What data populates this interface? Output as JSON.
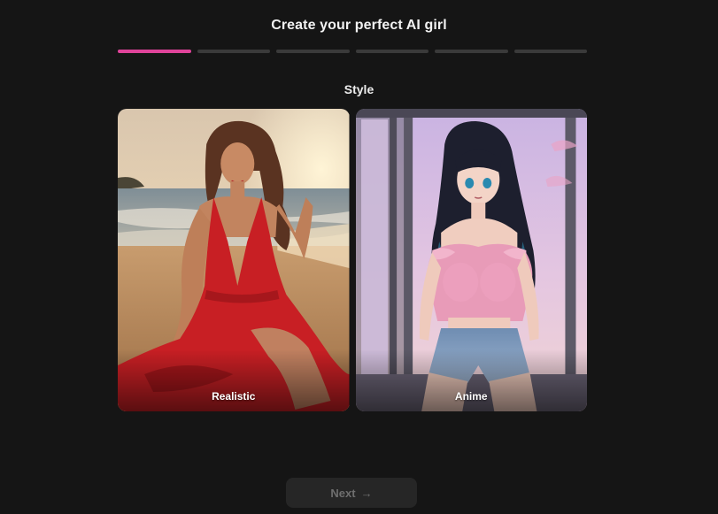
{
  "header": {
    "title": "Create your perfect AI girl"
  },
  "progress": {
    "total_steps": 6,
    "current_step": 1
  },
  "section": {
    "title": "Style"
  },
  "options": [
    {
      "label": "Realistic"
    },
    {
      "label": "Anime"
    }
  ],
  "footer": {
    "next_label": "Next",
    "next_icon": "arrow-right-icon",
    "next_enabled": false
  },
  "colors": {
    "background": "#151515",
    "accent": "#e0439a",
    "progress_inactive": "#3a3a3a",
    "button_bg": "#262626",
    "button_text_disabled": "#6e6e6e"
  }
}
